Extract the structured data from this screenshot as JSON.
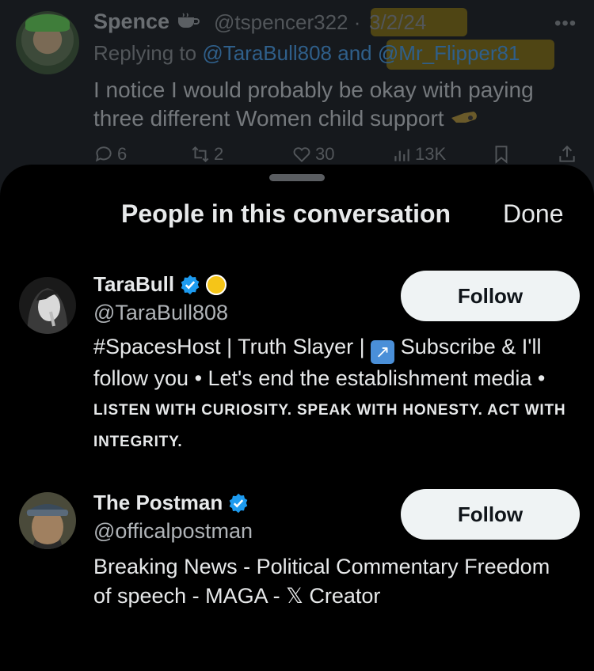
{
  "background_tweet": {
    "name": "Spence",
    "handle": "@tspencer322",
    "separator": "·",
    "date": "3/2/24",
    "reply_prefix": "Replying to",
    "reply_mention_1": "@TaraBull808",
    "reply_and": "and",
    "reply_mention_2": "@Mr_Flipper81",
    "text": "I notice I would probably be okay with paying three different Women child support",
    "more": "•••",
    "actions": {
      "replies": "6",
      "reposts": "2",
      "likes": "30",
      "views": "13K"
    }
  },
  "sheet": {
    "title": "People in this conversation",
    "done_label": "Done"
  },
  "people": [
    {
      "name": "TaraBull",
      "handle": "@TaraBull808",
      "bio_line": "#SpacesHost | Truth Slayer |",
      "bio_line_2": "Subscribe & I'll follow you • Let's end the establishment media •",
      "bio_caps": "LISTEN WITH CURIOSITY. SPEAK WITH HONESTY. ACT WITH INTEGRITY.",
      "follow_label": "Follow"
    },
    {
      "name": "The Postman",
      "handle": "@officalpostman",
      "bio_before_x": "Breaking News - Political Commentary Freedom of speech - MAGA -",
      "x_glyph": "𝕏",
      "bio_after_x": "Creator",
      "follow_label": "Follow"
    }
  ],
  "colors": {
    "verified_blue": "#1d9bf0",
    "highlight": "#6e5d10",
    "follow_bg": "#eff3f4"
  }
}
